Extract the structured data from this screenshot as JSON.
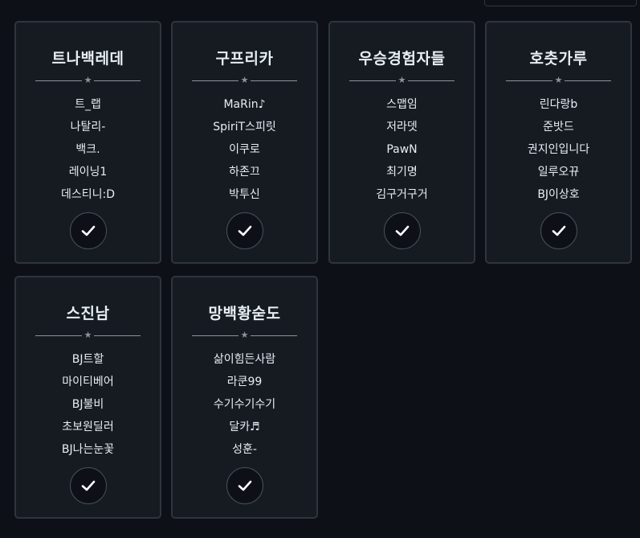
{
  "teams": [
    {
      "name": "트나백레데",
      "members": [
        "트_랩",
        "나탈리-",
        "백크.",
        "레이닝1",
        "데스티니:D"
      ],
      "divider_icon": "star-icon",
      "action_icon": "checkmark-icon"
    },
    {
      "name": "구프리카",
      "members": [
        "MaRin♪",
        "SpiriT스피릿",
        "이쿠로",
        "하존끄",
        "박투신"
      ],
      "divider_icon": "star-icon",
      "action_icon": "checkmark-icon"
    },
    {
      "name": "우승경험자들",
      "members": [
        "스맵임",
        "저라뎃",
        "PawN",
        "최기명",
        "김구거구거"
      ],
      "divider_icon": "star-icon",
      "action_icon": "checkmark-icon"
    },
    {
      "name": "호츳가루",
      "members": [
        "린다랑b",
        "준밧드",
        "권지인입니다",
        "일루오뀨",
        "BJ이상호"
      ],
      "divider_icon": "star-icon",
      "action_icon": "checkmark-icon"
    },
    {
      "name": "스진남",
      "members": [
        "BJ트할",
        "마이티베어",
        "BJ불비",
        "초보원딜러",
        "BJ나는눈꽃"
      ],
      "divider_icon": "star-icon",
      "action_icon": "checkmark-icon"
    },
    {
      "name": "망백황숟도",
      "members": [
        "삶이힘든사람",
        "라쿤99",
        "수기수기수기",
        "달카♬",
        "성훈-"
      ],
      "divider_icon": "star-icon",
      "action_icon": "checkmark-icon"
    }
  ],
  "colors": {
    "background": "#0d1117",
    "card": "#161b22",
    "border": "#2f353d",
    "text": "#e6edf3",
    "muted": "#8b949e"
  }
}
